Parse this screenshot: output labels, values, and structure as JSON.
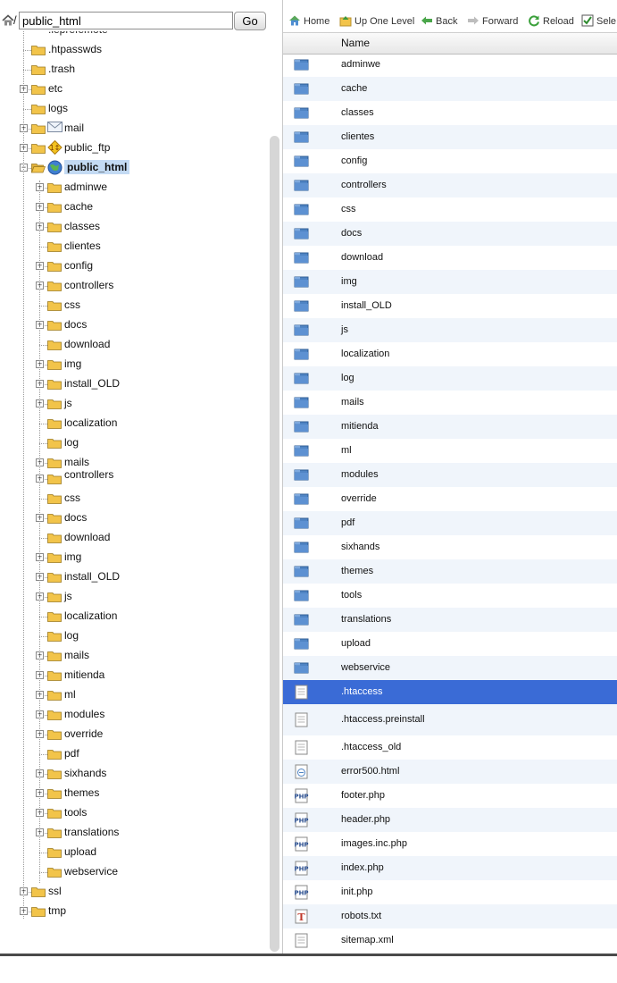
{
  "path_bar": {
    "path_value": "public_html",
    "go_label": "Go"
  },
  "toolbar": {
    "home": "Home",
    "up": "Up One Level",
    "back": "Back",
    "forward": "Forward",
    "reload": "Reload",
    "select": "Sele"
  },
  "table": {
    "col_name": "Name"
  },
  "tree": {
    "cut_top_label": ".leprefemote",
    "nodes": [
      {
        "label": ".htpasswds",
        "indent": 0,
        "has_exp": false,
        "icon": "folder-icon"
      },
      {
        "label": ".trash",
        "indent": 0,
        "has_exp": false,
        "icon": "folder-icon"
      },
      {
        "label": "etc",
        "indent": 0,
        "has_exp": true,
        "icon": "folder-icon"
      },
      {
        "label": "logs",
        "indent": 0,
        "has_exp": false,
        "icon": "folder-icon"
      },
      {
        "label": "mail",
        "indent": 0,
        "has_exp": true,
        "icon": "folder-icon",
        "badge": "mail-envelope-icon"
      },
      {
        "label": "public_ftp",
        "indent": 0,
        "has_exp": true,
        "icon": "folder-icon",
        "badge": "ftp-badge-icon"
      },
      {
        "label": "public_html",
        "indent": 0,
        "has_exp": true,
        "expanded": true,
        "icon": "folder-open-icon",
        "badge": "globe-icon",
        "selected": true
      },
      {
        "label": "adminwe",
        "indent": 1,
        "has_exp": true,
        "icon": "folder-icon"
      },
      {
        "label": "cache",
        "indent": 1,
        "has_exp": true,
        "icon": "folder-icon"
      },
      {
        "label": "classes",
        "indent": 1,
        "has_exp": true,
        "icon": "folder-icon"
      },
      {
        "label": "clientes",
        "indent": 1,
        "has_exp": false,
        "icon": "folder-icon"
      },
      {
        "label": "config",
        "indent": 1,
        "has_exp": true,
        "icon": "folder-icon"
      },
      {
        "label": "controllers",
        "indent": 1,
        "has_exp": true,
        "icon": "folder-icon"
      },
      {
        "label": "css",
        "indent": 1,
        "has_exp": false,
        "icon": "folder-icon"
      },
      {
        "label": "docs",
        "indent": 1,
        "has_exp": true,
        "icon": "folder-icon"
      },
      {
        "label": "download",
        "indent": 1,
        "has_exp": false,
        "icon": "folder-icon"
      },
      {
        "label": "img",
        "indent": 1,
        "has_exp": true,
        "icon": "folder-icon"
      },
      {
        "label": "install_OLD",
        "indent": 1,
        "has_exp": true,
        "icon": "folder-icon"
      },
      {
        "label": "js",
        "indent": 1,
        "has_exp": true,
        "icon": "folder-icon"
      },
      {
        "label": "localization",
        "indent": 1,
        "has_exp": false,
        "icon": "folder-icon"
      },
      {
        "label": "log",
        "indent": 1,
        "has_exp": false,
        "icon": "folder-icon"
      },
      {
        "label": "mails",
        "indent": 1,
        "has_exp": true,
        "icon": "folder-icon"
      },
      {
        "label": "controllers",
        "indent": 1,
        "has_exp": true,
        "icon": "folder-icon",
        "partial": true
      },
      {
        "label": "css",
        "indent": 1,
        "has_exp": false,
        "icon": "folder-icon"
      },
      {
        "label": "docs",
        "indent": 1,
        "has_exp": true,
        "icon": "folder-icon"
      },
      {
        "label": "download",
        "indent": 1,
        "has_exp": false,
        "icon": "folder-icon"
      },
      {
        "label": "img",
        "indent": 1,
        "has_exp": true,
        "icon": "folder-icon"
      },
      {
        "label": "install_OLD",
        "indent": 1,
        "has_exp": true,
        "icon": "folder-icon"
      },
      {
        "label": "js",
        "indent": 1,
        "has_exp": true,
        "icon": "folder-icon"
      },
      {
        "label": "localization",
        "indent": 1,
        "has_exp": false,
        "icon": "folder-icon"
      },
      {
        "label": "log",
        "indent": 1,
        "has_exp": false,
        "icon": "folder-icon"
      },
      {
        "label": "mails",
        "indent": 1,
        "has_exp": true,
        "icon": "folder-icon"
      },
      {
        "label": "mitienda",
        "indent": 1,
        "has_exp": true,
        "icon": "folder-icon"
      },
      {
        "label": "ml",
        "indent": 1,
        "has_exp": true,
        "icon": "folder-icon"
      },
      {
        "label": "modules",
        "indent": 1,
        "has_exp": true,
        "icon": "folder-icon"
      },
      {
        "label": "override",
        "indent": 1,
        "has_exp": true,
        "icon": "folder-icon"
      },
      {
        "label": "pdf",
        "indent": 1,
        "has_exp": false,
        "icon": "folder-icon"
      },
      {
        "label": "sixhands",
        "indent": 1,
        "has_exp": true,
        "icon": "folder-icon"
      },
      {
        "label": "themes",
        "indent": 1,
        "has_exp": true,
        "icon": "folder-icon"
      },
      {
        "label": "tools",
        "indent": 1,
        "has_exp": true,
        "icon": "folder-icon"
      },
      {
        "label": "translations",
        "indent": 1,
        "has_exp": true,
        "icon": "folder-icon"
      },
      {
        "label": "upload",
        "indent": 1,
        "has_exp": false,
        "icon": "folder-icon"
      },
      {
        "label": "webservice",
        "indent": 1,
        "has_exp": false,
        "icon": "folder-icon"
      },
      {
        "label": "ssl",
        "indent": 0,
        "has_exp": true,
        "icon": "folder-icon"
      },
      {
        "label": "tmp",
        "indent": 0,
        "has_exp": true,
        "icon": "folder-icon"
      }
    ]
  },
  "files": [
    {
      "name": "adminwe",
      "type": "folder"
    },
    {
      "name": "cache",
      "type": "folder"
    },
    {
      "name": "classes",
      "type": "folder"
    },
    {
      "name": "clientes",
      "type": "folder"
    },
    {
      "name": "config",
      "type": "folder"
    },
    {
      "name": "controllers",
      "type": "folder"
    },
    {
      "name": "css",
      "type": "folder"
    },
    {
      "name": "docs",
      "type": "folder"
    },
    {
      "name": "download",
      "type": "folder"
    },
    {
      "name": "img",
      "type": "folder"
    },
    {
      "name": "install_OLD",
      "type": "folder"
    },
    {
      "name": "js",
      "type": "folder"
    },
    {
      "name": "localization",
      "type": "folder"
    },
    {
      "name": "log",
      "type": "folder"
    },
    {
      "name": "mails",
      "type": "folder"
    },
    {
      "name": "mitienda",
      "type": "folder"
    },
    {
      "name": "ml",
      "type": "folder"
    },
    {
      "name": "modules",
      "type": "folder"
    },
    {
      "name": "override",
      "type": "folder"
    },
    {
      "name": "pdf",
      "type": "folder"
    },
    {
      "name": "sixhands",
      "type": "folder"
    },
    {
      "name": "themes",
      "type": "folder"
    },
    {
      "name": "tools",
      "type": "folder"
    },
    {
      "name": "translations",
      "type": "folder"
    },
    {
      "name": "upload",
      "type": "folder"
    },
    {
      "name": "webservice",
      "type": "folder"
    },
    {
      "name": ".htaccess",
      "type": "file",
      "selected": true
    },
    {
      "name": ".htaccess.preinstall",
      "type": "file"
    },
    {
      "name": ".htaccess_old",
      "type": "file"
    },
    {
      "name": "error500.html",
      "type": "html"
    },
    {
      "name": "footer.php",
      "type": "php"
    },
    {
      "name": "header.php",
      "type": "php"
    },
    {
      "name": "images.inc.php",
      "type": "php"
    },
    {
      "name": "index.php",
      "type": "php"
    },
    {
      "name": "init.php",
      "type": "php"
    },
    {
      "name": "robots.txt",
      "type": "txt"
    },
    {
      "name": "sitemap.xml",
      "type": "file"
    }
  ],
  "colors": {
    "selected_row": "#3a6bd6",
    "alt_row": "#f0f5fb",
    "tree_selected": "#c3daf3",
    "folder_blue": "#4f84c4",
    "folder_yellow": "#f2c44a"
  }
}
